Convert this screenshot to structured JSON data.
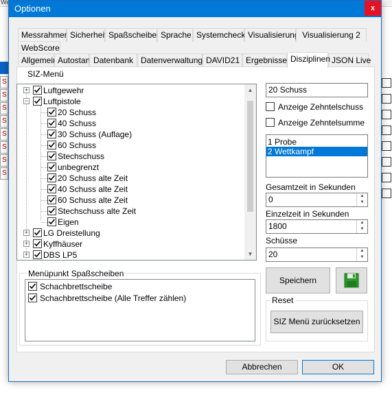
{
  "bg": {
    "top_text": "We",
    "left_rows": [
      "S",
      "S",
      "S",
      "S",
      "S",
      "S",
      "S",
      "S"
    ]
  },
  "window": {
    "title": "Optionen",
    "close_glyph": "x"
  },
  "tabs_row1": [
    "Messrahmen",
    "Sicherheit",
    "Spaßscheiben",
    "Sprache",
    "Systemcheck",
    "Visualisierung",
    "Visualisierung 2"
  ],
  "tabs_row2": [
    "WebScore"
  ],
  "tabs_row3": [
    "Allgemein",
    "Autostart",
    "Datenbank",
    "Datenverwaltung",
    "DAVID21",
    "Ergebnisse",
    "Disziplinen",
    "JSON Live"
  ],
  "active_tab": "Disziplinen",
  "siz_menu": {
    "legend": "SIZ-Menü",
    "tree": [
      {
        "label": "Luftgewehr",
        "level": 0,
        "expander": "+",
        "checked": true
      },
      {
        "label": "Luftpistole",
        "level": 0,
        "expander": "−",
        "checked": true
      },
      {
        "label": "20 Schuss",
        "level": 1,
        "checked": true
      },
      {
        "label": "40 Schuss",
        "level": 1,
        "checked": true
      },
      {
        "label": "30 Schuss (Auflage)",
        "level": 1,
        "checked": true
      },
      {
        "label": "60 Schuss",
        "level": 1,
        "checked": true
      },
      {
        "label": "Stechschuss",
        "level": 1,
        "checked": true
      },
      {
        "label": "unbegrenzt",
        "level": 1,
        "checked": true
      },
      {
        "label": "20 Schuss alte Zeit",
        "level": 1,
        "checked": true
      },
      {
        "label": "40 Schuss alte Zeit",
        "level": 1,
        "checked": true
      },
      {
        "label": "60 Schuss alte Zeit",
        "level": 1,
        "checked": true
      },
      {
        "label": "Stechschuss alte Zeit",
        "level": 1,
        "checked": true
      },
      {
        "label": "Eigen",
        "level": 1,
        "checked": true
      },
      {
        "label": "LG Dreistellung",
        "level": 0,
        "expander": "+",
        "checked": true
      },
      {
        "label": "Kyffhäuser",
        "level": 0,
        "expander": "+",
        "checked": true
      },
      {
        "label": "DBS LP5",
        "level": 0,
        "expander": "+",
        "checked": true
      }
    ]
  },
  "fun_targets": {
    "legend": "Menüpunkt Spaßscheiben",
    "items": [
      {
        "label": "Schachbrettscheibe",
        "checked": true
      },
      {
        "label": "Schachbrettscheibe (Alle Treffer zählen)",
        "checked": true
      }
    ]
  },
  "details": {
    "name_value": "20 Schuss",
    "show_tenth_shot": {
      "label": "Anzeige Zehntelschuss",
      "checked": false
    },
    "show_tenth_sum": {
      "label": "Anzeige Zehntelsumme",
      "checked": false
    },
    "phases": [
      {
        "label": "1 Probe",
        "selected": false
      },
      {
        "label": "2 Wettkampf",
        "selected": true
      }
    ],
    "total_time_label": "Gesamtzeit in Sekunden",
    "total_time_value": "0",
    "single_time_label": "Einzelzeit in Sekunden",
    "single_time_value": "1800",
    "shots_label": "Schüsse",
    "shots_value": "20",
    "save_label": "Speichern",
    "save_icon": "floppy-disk-icon"
  },
  "reset": {
    "legend": "Reset",
    "button_label": "SIZ Menü zurücksetzen"
  },
  "footer": {
    "cancel_label": "Abbrechen",
    "ok_label": "OK"
  },
  "colors": {
    "titlebar": "#0078d7",
    "close": "#e81123",
    "selection": "#0078d7",
    "save_icon_green": "#2a9a2a"
  }
}
